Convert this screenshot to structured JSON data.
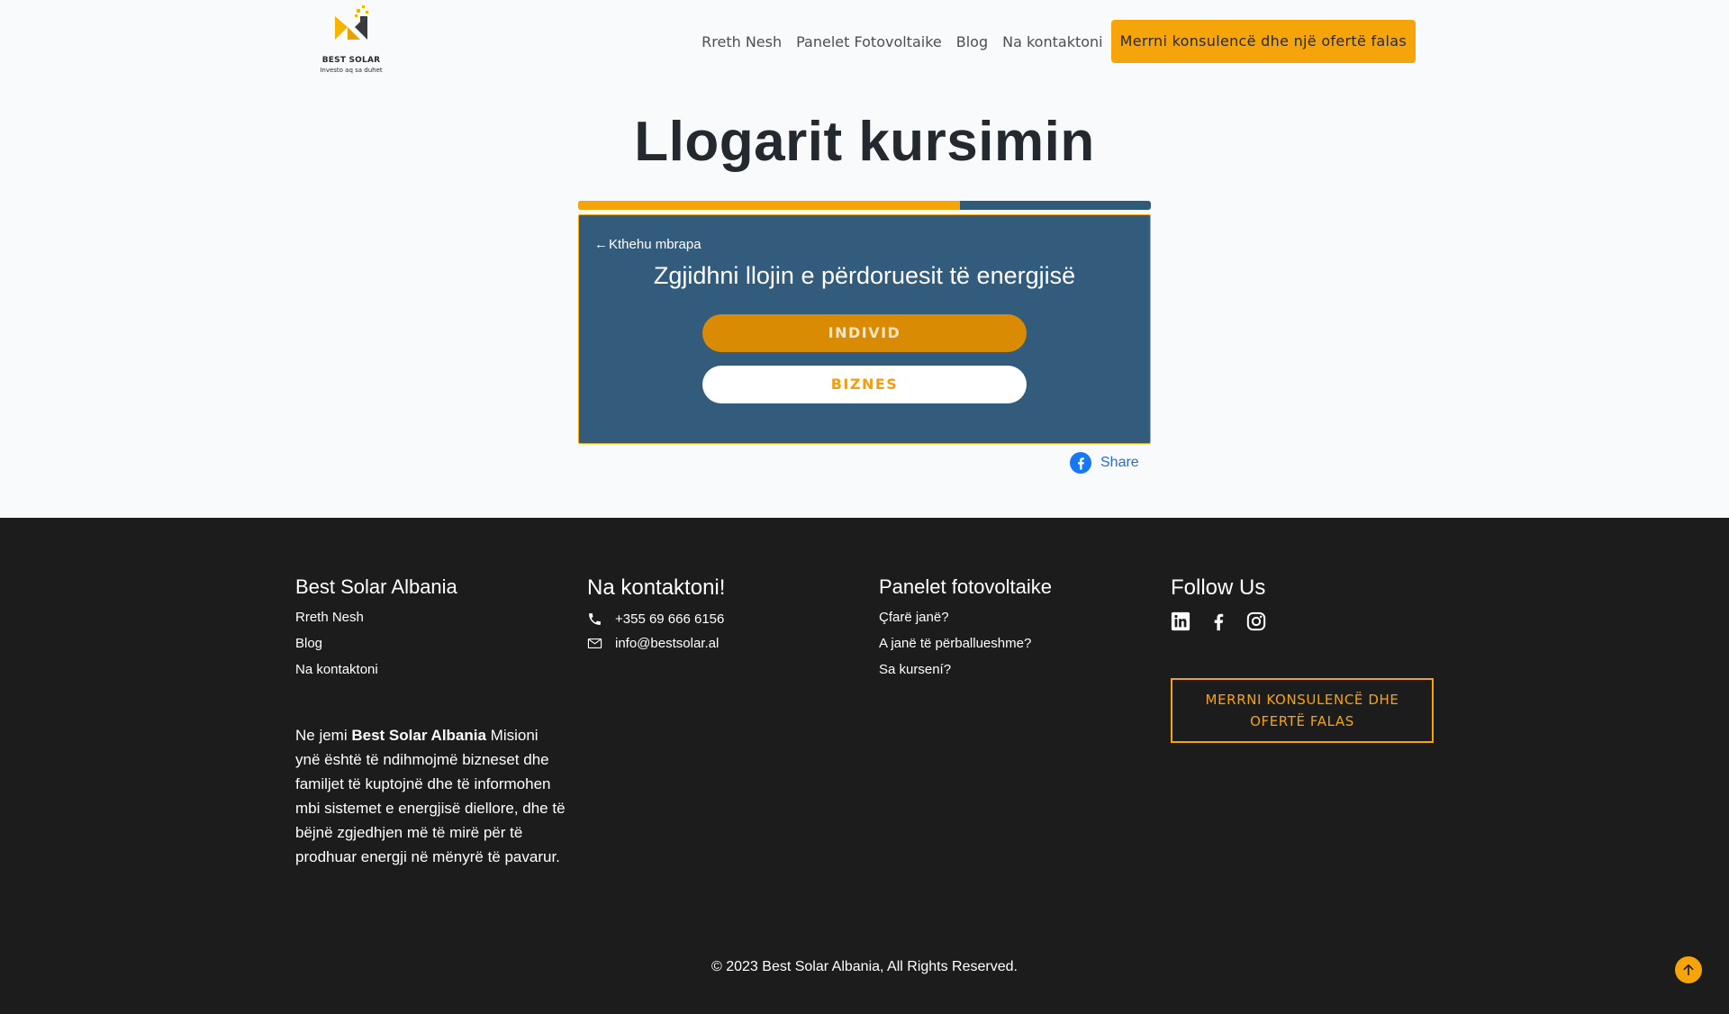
{
  "header": {
    "logo_name": "BEST SOLAR",
    "logo_tagline": "Investo aq sa duhet",
    "nav": [
      {
        "label": "Rreth Nesh"
      },
      {
        "label": "Panelet Fotovoltaike"
      },
      {
        "label": "Blog"
      },
      {
        "label": "Na kontaktoni"
      }
    ],
    "cta_label": "Merrni konsulencë dhe një ofertë falas"
  },
  "main": {
    "title": "Llogarit kursimin",
    "progress_fraction": 0.667,
    "card": {
      "back_label": "Kthehu mbrapa",
      "question": "Zgjidhni llojin e përdoruesit të energjisë",
      "options": [
        {
          "label": "INDIVID",
          "selected": true
        },
        {
          "label": "BIZNES",
          "selected": false
        }
      ]
    },
    "share_label": "Share"
  },
  "footer": {
    "col1": {
      "title": "Best Solar Albania",
      "links": [
        "Rreth Nesh",
        "Blog",
        "Na kontaktoni"
      ]
    },
    "col2": {
      "title": "Na kontaktoni!",
      "phone": "+355 69 666 6156",
      "email": "info@bestsolar.al"
    },
    "col3": {
      "title": "Panelet fotovoltaike",
      "links": [
        "Çfarë janë?",
        "A janë të përballueshme?",
        "Sa kursení?"
      ]
    },
    "col4": {
      "title": "Follow Us",
      "cta_label": "MERRNI KONSULENCË DHE OFERTË FALAS"
    },
    "about": {
      "prefix": "Ne jemi ",
      "brand": "Best Solar Albania",
      "text": " Misioni ynë është të ndihmojmë bizneset dhe familjet të kuptojnë dhe të informohen mbi sistemet e energjisë diellore, dhe të bëjnë zgjedhjen më të mirë për të prodhuar energji në mënyrë të pavarur."
    },
    "copyright": "© 2023 Best Solar Albania, All Rights Reserved."
  },
  "colors": {
    "accent": "#f5a509",
    "card_bg": "#335b7c",
    "footer_bg": "#1c1c1d",
    "share": "#2a6ad1"
  },
  "icons": {
    "logo": "best-solar-logo-icon",
    "back": "arrow-left-icon",
    "share": "facebook-icon",
    "phone": "phone-icon",
    "email": "envelope-icon",
    "social": [
      "linkedin-icon",
      "facebook-icon",
      "instagram-icon"
    ],
    "scroll": "arrow-up-icon"
  }
}
